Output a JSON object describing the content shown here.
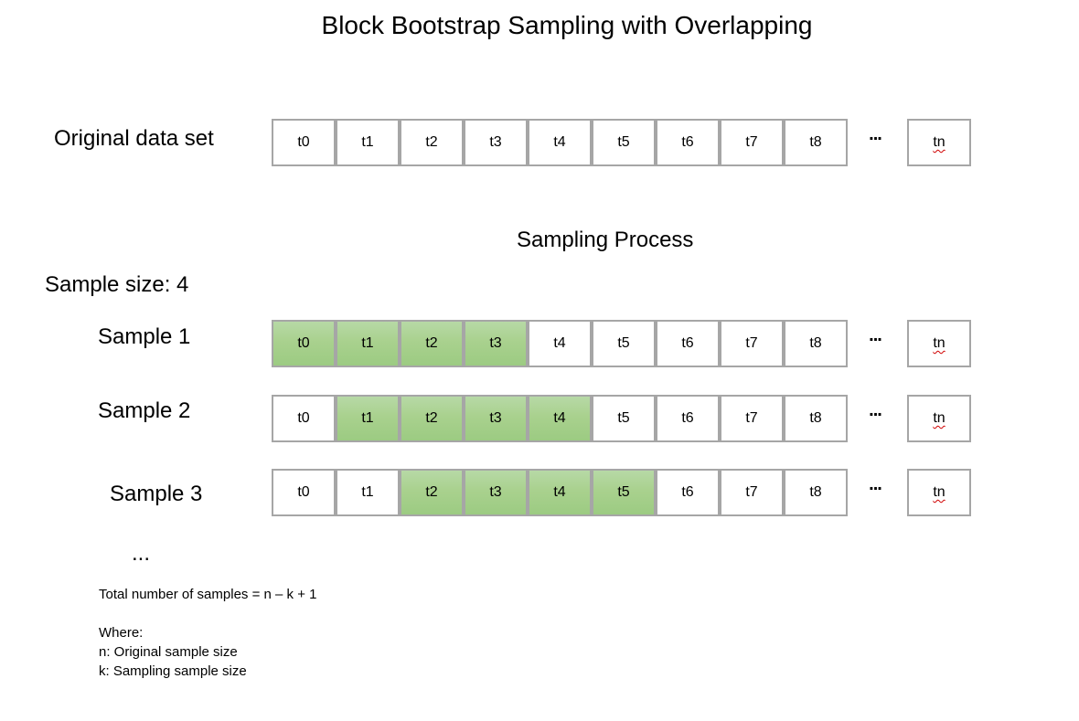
{
  "title": "Block Bootstrap Sampling with Overlapping",
  "original": {
    "label": "Original data set",
    "cells": [
      "t0",
      "t1",
      "t2",
      "t3",
      "t4",
      "t5",
      "t6",
      "t7",
      "t8"
    ],
    "ellipsis": "...",
    "last": "tn",
    "highlight": []
  },
  "process_title": "Sampling Process",
  "sample_size_label": "Sample size: 4",
  "samples": [
    {
      "label": "Sample 1",
      "cells": [
        "t0",
        "t1",
        "t2",
        "t3",
        "t4",
        "t5",
        "t6",
        "t7",
        "t8"
      ],
      "ellipsis": "...",
      "last": "tn",
      "highlight": [
        0,
        1,
        2,
        3
      ]
    },
    {
      "label": "Sample 2",
      "cells": [
        "t0",
        "t1",
        "t2",
        "t3",
        "t4",
        "t5",
        "t6",
        "t7",
        "t8"
      ],
      "ellipsis": "...",
      "last": "tn",
      "highlight": [
        1,
        2,
        3,
        4
      ]
    },
    {
      "label": "Sample 3",
      "cells": [
        "t0",
        "t1",
        "t2",
        "t3",
        "t4",
        "t5",
        "t6",
        "t7",
        "t8"
      ],
      "ellipsis": "...",
      "last": "tn",
      "highlight": [
        2,
        3,
        4,
        5
      ]
    }
  ],
  "more_samples": "...",
  "notes": {
    "formula": "Total number of samples = n – k + 1",
    "where": "Where:",
    "n_def": "n: Original sample size",
    "k_def": "k: Sampling sample size"
  },
  "colors": {
    "highlight": "#a9d18e",
    "border": "#a6a6a6"
  }
}
